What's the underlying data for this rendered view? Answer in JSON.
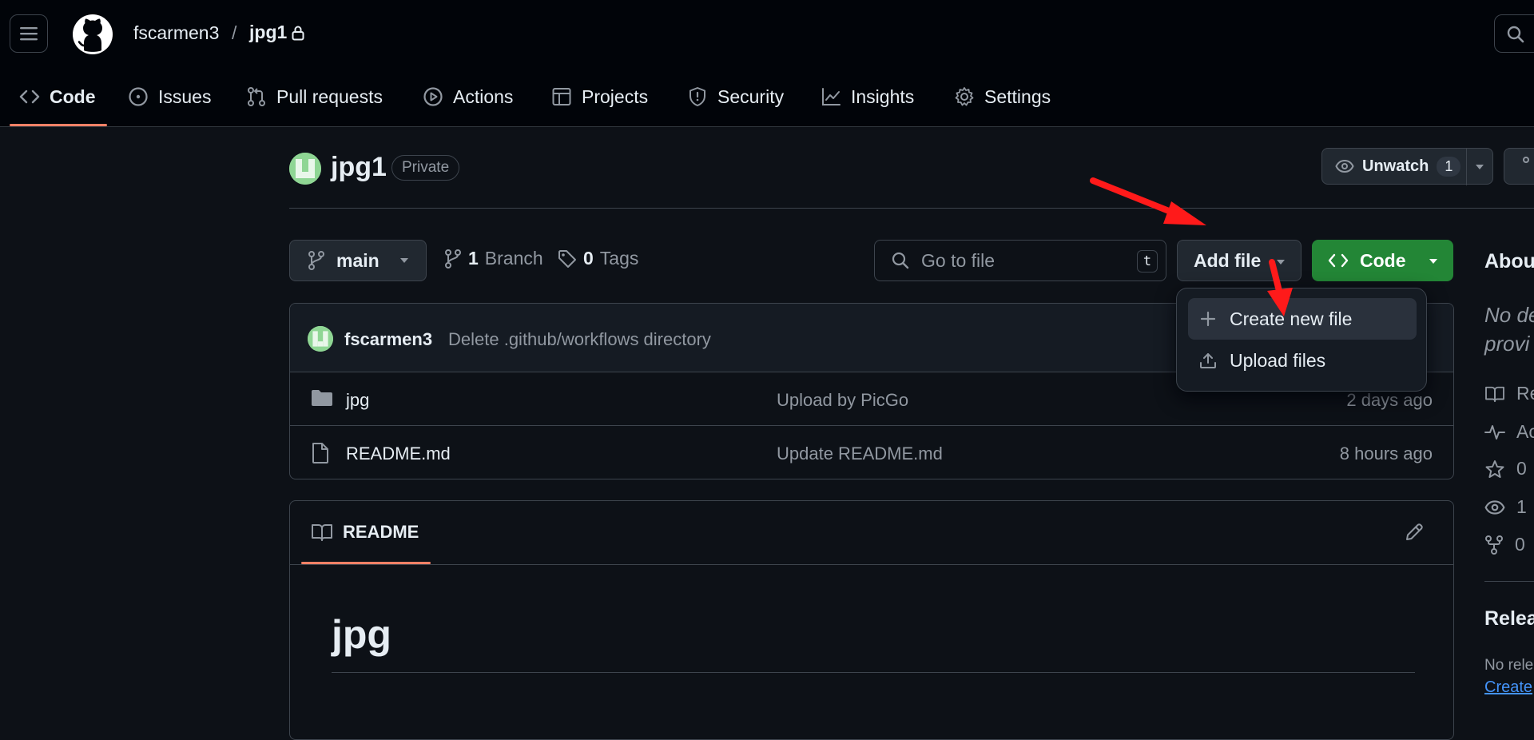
{
  "header": {
    "owner": "fscarmen3",
    "separator": "/",
    "repo": "jpg1"
  },
  "nav": {
    "tabs": [
      {
        "label": "Code",
        "icon": "code-icon",
        "active": true
      },
      {
        "label": "Issues",
        "icon": "issue-opened-icon"
      },
      {
        "label": "Pull requests",
        "icon": "git-pull-request-icon"
      },
      {
        "label": "Actions",
        "icon": "play-icon"
      },
      {
        "label": "Projects",
        "icon": "table-icon"
      },
      {
        "label": "Security",
        "icon": "shield-icon"
      },
      {
        "label": "Insights",
        "icon": "graph-icon"
      },
      {
        "label": "Settings",
        "icon": "gear-icon"
      }
    ]
  },
  "repo": {
    "name": "jpg1",
    "visibility": "Private",
    "unwatch_label": "Unwatch",
    "watch_count": "1"
  },
  "toolbar": {
    "branch": "main",
    "branch_count": "1",
    "branch_label": "Branch",
    "tag_count": "0",
    "tag_label": "Tags",
    "goto_placeholder": "Go to file",
    "goto_shortcut": "t",
    "add_file_label": "Add file",
    "code_label": "Code"
  },
  "add_file_menu": {
    "items": [
      {
        "label": "Create new file",
        "icon": "plus-icon",
        "highlighted": true
      },
      {
        "label": "Upload files",
        "icon": "upload-icon"
      }
    ]
  },
  "latest_commit": {
    "author": "fscarmen3",
    "message": "Delete .github/workflows directory"
  },
  "files": [
    {
      "name": "jpg",
      "type": "folder",
      "message": "Upload by PicGo",
      "age": "2 days ago"
    },
    {
      "name": "README.md",
      "type": "file",
      "message": "Update README.md",
      "age": "8 hours ago"
    }
  ],
  "readme": {
    "tab_label": "README",
    "heading": "jpg"
  },
  "sidebar": {
    "about_title": "Abou",
    "description_line1": "No de",
    "description_line2": "provi",
    "items": [
      {
        "icon": "book-icon",
        "text": "Re"
      },
      {
        "icon": "pulse-icon",
        "text": "Ac"
      },
      {
        "icon": "star-icon",
        "text": "0"
      },
      {
        "icon": "eye-icon",
        "text": "1"
      },
      {
        "icon": "repo-forked-icon",
        "text": "0"
      }
    ],
    "releases_title": "Relea",
    "releases_none": "No rele",
    "releases_create": "Create"
  },
  "colors": {
    "background": "#0d1117",
    "header": "#010409",
    "border": "#3d444d",
    "accent_underline": "#f78166",
    "code_button": "#238636",
    "link": "#4493f8",
    "annotation_arrow": "#ff1a1a"
  }
}
